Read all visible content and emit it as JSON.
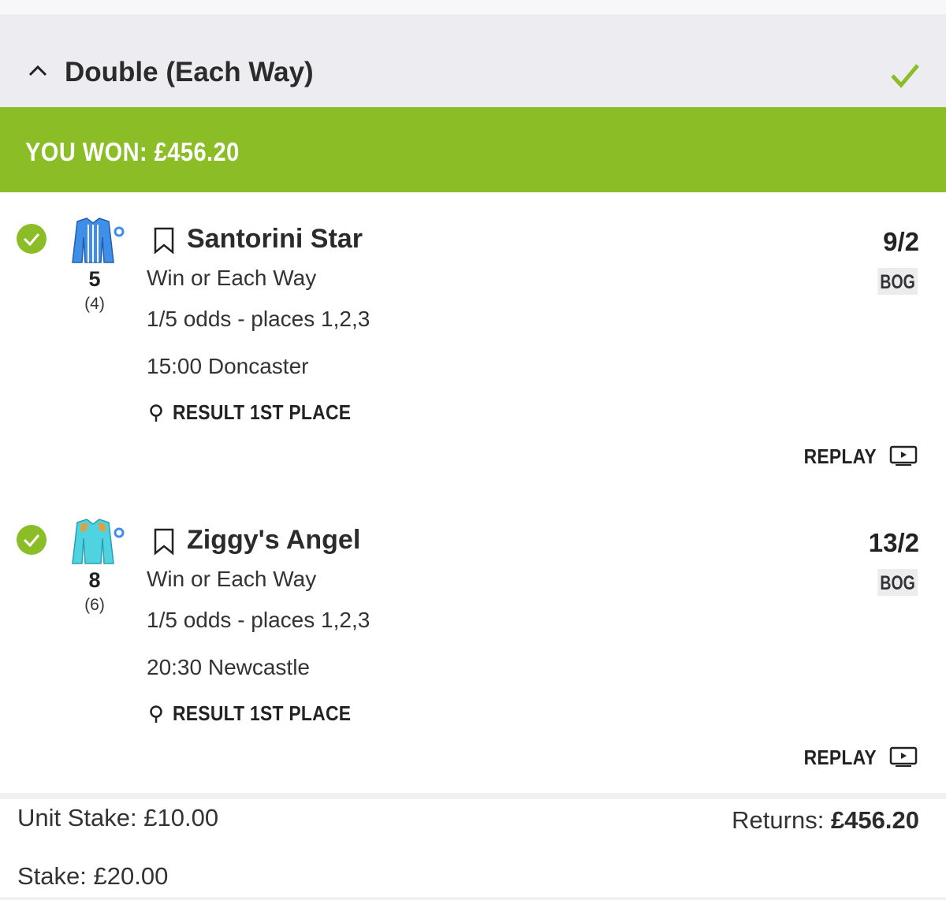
{
  "colors": {
    "accent": "#8bbd27",
    "header_bg": "#ededf1",
    "text": "#2b2b2b",
    "silk_blue": "#3f8fe8",
    "silk_teal": "#4fd3e0"
  },
  "bet": {
    "title": "Double (Each Way)",
    "collapse_icon": "chevron-up-icon",
    "status_icon": "check-icon",
    "won_text": "YOU WON: £456.20"
  },
  "selections": [
    {
      "number": "5",
      "draw": "(4)",
      "name": "Santorini Star",
      "market": "Win or Each Way",
      "terms": "1/5 odds - places 1,2,3",
      "race": "15:00 Doncaster",
      "result": "RESULT 1ST PLACE",
      "odds": "9/2",
      "bog": "BOG",
      "replay": "REPLAY"
    },
    {
      "number": "8",
      "draw": "(6)",
      "name": "Ziggy's Angel",
      "market": "Win or Each Way",
      "terms": "1/5 odds - places 1,2,3",
      "race": "20:30 Newcastle",
      "result": "RESULT 1ST PLACE",
      "odds": "13/2",
      "bog": "BOG",
      "replay": "REPLAY"
    }
  ],
  "summary": {
    "unit_stake": "Unit Stake: £10.00",
    "returns_label": "Returns: ",
    "returns_value": "£456.20",
    "stake": "Stake: £20.00"
  }
}
